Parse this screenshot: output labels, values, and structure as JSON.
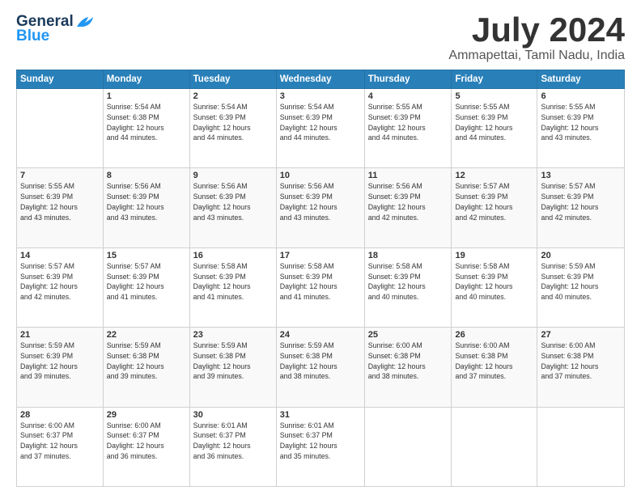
{
  "logo": {
    "line1": "General",
    "line2": "Blue"
  },
  "header": {
    "month": "July 2024",
    "location": "Ammapettai, Tamil Nadu, India"
  },
  "days_of_week": [
    "Sunday",
    "Monday",
    "Tuesday",
    "Wednesday",
    "Thursday",
    "Friday",
    "Saturday"
  ],
  "weeks": [
    [
      {
        "day": "",
        "info": ""
      },
      {
        "day": "1",
        "info": "Sunrise: 5:54 AM\nSunset: 6:38 PM\nDaylight: 12 hours\nand 44 minutes."
      },
      {
        "day": "2",
        "info": "Sunrise: 5:54 AM\nSunset: 6:39 PM\nDaylight: 12 hours\nand 44 minutes."
      },
      {
        "day": "3",
        "info": "Sunrise: 5:54 AM\nSunset: 6:39 PM\nDaylight: 12 hours\nand 44 minutes."
      },
      {
        "day": "4",
        "info": "Sunrise: 5:55 AM\nSunset: 6:39 PM\nDaylight: 12 hours\nand 44 minutes."
      },
      {
        "day": "5",
        "info": "Sunrise: 5:55 AM\nSunset: 6:39 PM\nDaylight: 12 hours\nand 44 minutes."
      },
      {
        "day": "6",
        "info": "Sunrise: 5:55 AM\nSunset: 6:39 PM\nDaylight: 12 hours\nand 43 minutes."
      }
    ],
    [
      {
        "day": "7",
        "info": "Sunrise: 5:55 AM\nSunset: 6:39 PM\nDaylight: 12 hours\nand 43 minutes."
      },
      {
        "day": "8",
        "info": "Sunrise: 5:56 AM\nSunset: 6:39 PM\nDaylight: 12 hours\nand 43 minutes."
      },
      {
        "day": "9",
        "info": "Sunrise: 5:56 AM\nSunset: 6:39 PM\nDaylight: 12 hours\nand 43 minutes."
      },
      {
        "day": "10",
        "info": "Sunrise: 5:56 AM\nSunset: 6:39 PM\nDaylight: 12 hours\nand 43 minutes."
      },
      {
        "day": "11",
        "info": "Sunrise: 5:56 AM\nSunset: 6:39 PM\nDaylight: 12 hours\nand 42 minutes."
      },
      {
        "day": "12",
        "info": "Sunrise: 5:57 AM\nSunset: 6:39 PM\nDaylight: 12 hours\nand 42 minutes."
      },
      {
        "day": "13",
        "info": "Sunrise: 5:57 AM\nSunset: 6:39 PM\nDaylight: 12 hours\nand 42 minutes."
      }
    ],
    [
      {
        "day": "14",
        "info": "Sunrise: 5:57 AM\nSunset: 6:39 PM\nDaylight: 12 hours\nand 42 minutes."
      },
      {
        "day": "15",
        "info": "Sunrise: 5:57 AM\nSunset: 6:39 PM\nDaylight: 12 hours\nand 41 minutes."
      },
      {
        "day": "16",
        "info": "Sunrise: 5:58 AM\nSunset: 6:39 PM\nDaylight: 12 hours\nand 41 minutes."
      },
      {
        "day": "17",
        "info": "Sunrise: 5:58 AM\nSunset: 6:39 PM\nDaylight: 12 hours\nand 41 minutes."
      },
      {
        "day": "18",
        "info": "Sunrise: 5:58 AM\nSunset: 6:39 PM\nDaylight: 12 hours\nand 40 minutes."
      },
      {
        "day": "19",
        "info": "Sunrise: 5:58 AM\nSunset: 6:39 PM\nDaylight: 12 hours\nand 40 minutes."
      },
      {
        "day": "20",
        "info": "Sunrise: 5:59 AM\nSunset: 6:39 PM\nDaylight: 12 hours\nand 40 minutes."
      }
    ],
    [
      {
        "day": "21",
        "info": "Sunrise: 5:59 AM\nSunset: 6:39 PM\nDaylight: 12 hours\nand 39 minutes."
      },
      {
        "day": "22",
        "info": "Sunrise: 5:59 AM\nSunset: 6:38 PM\nDaylight: 12 hours\nand 39 minutes."
      },
      {
        "day": "23",
        "info": "Sunrise: 5:59 AM\nSunset: 6:38 PM\nDaylight: 12 hours\nand 39 minutes."
      },
      {
        "day": "24",
        "info": "Sunrise: 5:59 AM\nSunset: 6:38 PM\nDaylight: 12 hours\nand 38 minutes."
      },
      {
        "day": "25",
        "info": "Sunrise: 6:00 AM\nSunset: 6:38 PM\nDaylight: 12 hours\nand 38 minutes."
      },
      {
        "day": "26",
        "info": "Sunrise: 6:00 AM\nSunset: 6:38 PM\nDaylight: 12 hours\nand 37 minutes."
      },
      {
        "day": "27",
        "info": "Sunrise: 6:00 AM\nSunset: 6:38 PM\nDaylight: 12 hours\nand 37 minutes."
      }
    ],
    [
      {
        "day": "28",
        "info": "Sunrise: 6:00 AM\nSunset: 6:37 PM\nDaylight: 12 hours\nand 37 minutes."
      },
      {
        "day": "29",
        "info": "Sunrise: 6:00 AM\nSunset: 6:37 PM\nDaylight: 12 hours\nand 36 minutes."
      },
      {
        "day": "30",
        "info": "Sunrise: 6:01 AM\nSunset: 6:37 PM\nDaylight: 12 hours\nand 36 minutes."
      },
      {
        "day": "31",
        "info": "Sunrise: 6:01 AM\nSunset: 6:37 PM\nDaylight: 12 hours\nand 35 minutes."
      },
      {
        "day": "",
        "info": ""
      },
      {
        "day": "",
        "info": ""
      },
      {
        "day": "",
        "info": ""
      }
    ]
  ]
}
